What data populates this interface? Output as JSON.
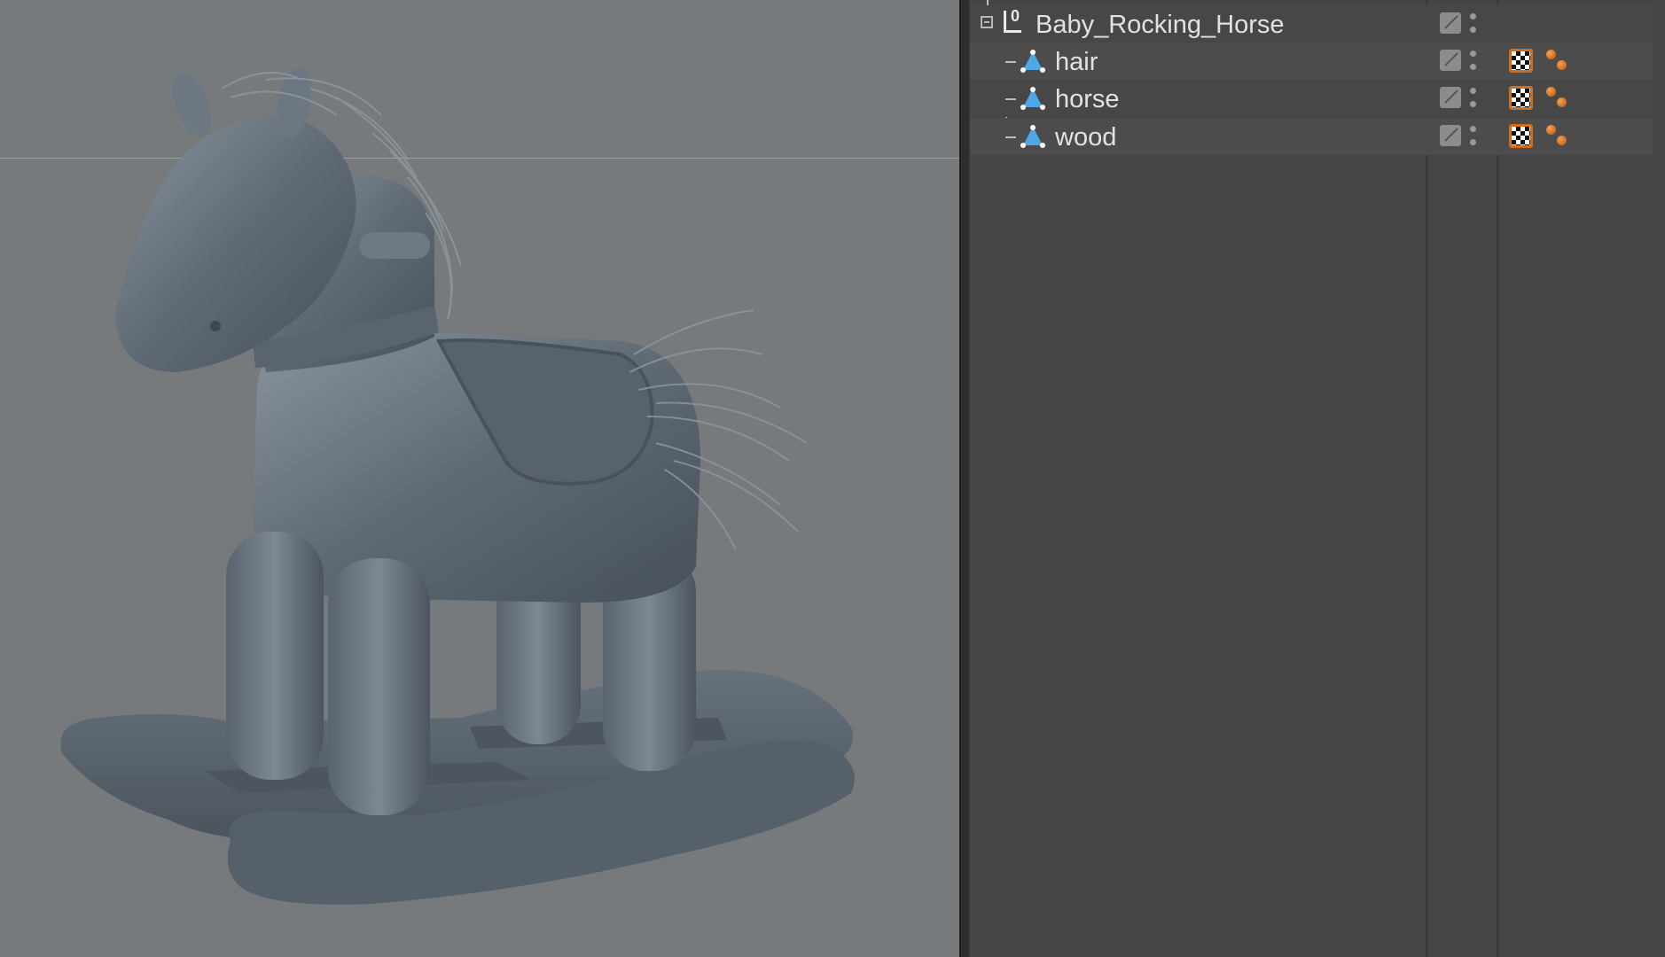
{
  "object_manager": {
    "objects": [
      {
        "name": "Baby_Rocking_Horse",
        "type": "null-icon",
        "expanded": true
      },
      {
        "name": "hair",
        "type": "polygon-icon"
      },
      {
        "name": "horse",
        "type": "polygon-icon"
      },
      {
        "name": "wood",
        "type": "polygon-icon"
      }
    ]
  },
  "colors": {
    "viewport_bg": "#777a7c",
    "manager_bg": "#454545",
    "model_gray": "#5c6670",
    "material_tag": "#d06e20"
  }
}
